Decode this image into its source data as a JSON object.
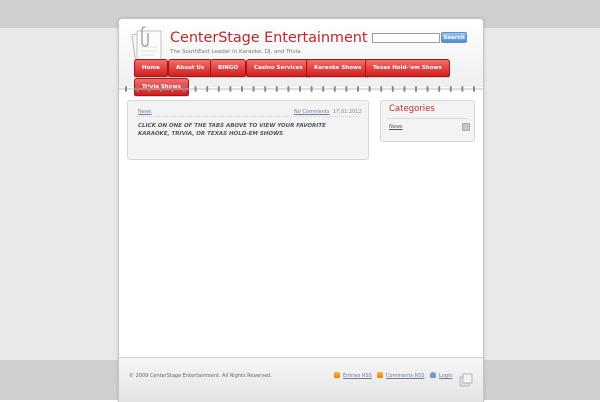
{
  "site": {
    "title": "CenterStage Entertainment",
    "tagline": "The SouthEast Leader in Karaoke, DJ, and Trivia"
  },
  "search": {
    "placeholder": "",
    "button_label": "Search"
  },
  "nav": {
    "tabs": [
      {
        "label": "Home"
      },
      {
        "label": "About Us"
      },
      {
        "label": "BINGO"
      },
      {
        "label": "Casino Services"
      },
      {
        "label": "Karaoke Shows"
      },
      {
        "label": "Texas Hold-'em Shows"
      },
      {
        "label": "Trivia Shows"
      }
    ]
  },
  "post": {
    "category": "News",
    "comments_link": "No Comments",
    "date": "17.01.2012",
    "text": "CLICK ON ONE OF THE TABS ABOVE TO VIEW YOUR FAVORITE KARAOKE, TRIVIA, OR TEXAS HOLD-EM SHOWS"
  },
  "sidebar": {
    "title": "Categories",
    "items": [
      {
        "label": "News"
      }
    ]
  },
  "footer": {
    "copyright": "© 2009 CenterStage Entertainment. All Rights Reserved.",
    "entries_rss": "Entries RSS",
    "comments_rss": "Comments RSS",
    "login": "Login"
  },
  "colors": {
    "accent": "#c1272d",
    "tab_red": "#d31d1d",
    "search_blue": "#4f8ad3",
    "background": "#e9e9e9"
  }
}
